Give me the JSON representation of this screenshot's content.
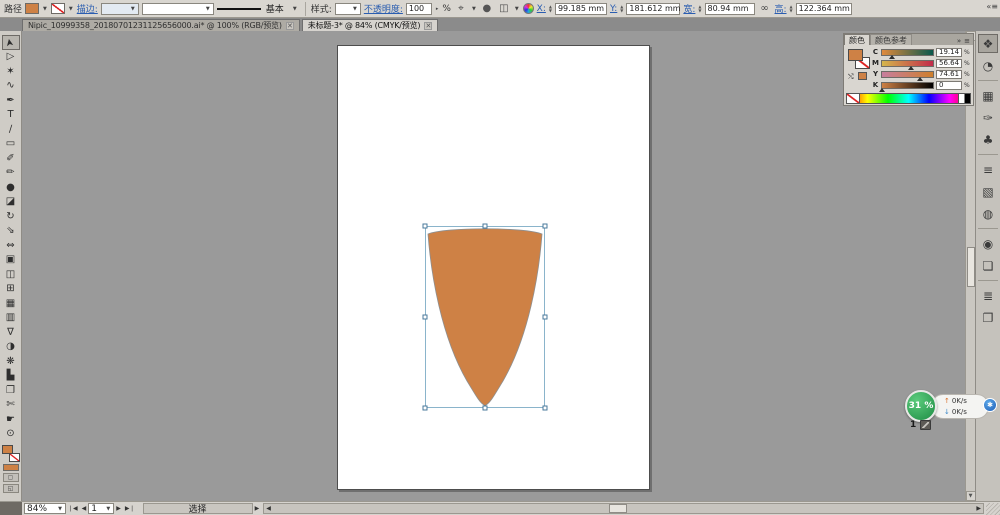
{
  "control_bar": {
    "object_label": "路径",
    "stroke_label": "描边:",
    "profile_value": "基本",
    "style_label": "样式:",
    "opacity_label": "不透明度:",
    "opacity_value": "100",
    "unit_percent": "%",
    "x_label": "X:",
    "x_value": "99.185 mm",
    "y_label": "Y:",
    "y_value": "181.612 mm",
    "w_label": "宽:",
    "w_value": "80.94 mm",
    "h_label": "高:",
    "h_value": "122.364 mm"
  },
  "tabs": [
    {
      "label": "Nipic_10999358_20180701231125656000.ai* @ 100% (RGB/预览)",
      "active": false
    },
    {
      "label": "未标题-3* @ 84% (CMYK/预览)",
      "active": true
    }
  ],
  "toolbar": {
    "tools": [
      {
        "name": "selection-tool",
        "glyph": "➤"
      },
      {
        "name": "direct-selection-tool",
        "glyph": "▷"
      },
      {
        "name": "magic-wand-tool",
        "glyph": "✶"
      },
      {
        "name": "lasso-tool",
        "glyph": "∿"
      },
      {
        "name": "pen-tool",
        "glyph": "✒"
      },
      {
        "name": "type-tool",
        "glyph": "T"
      },
      {
        "name": "line-segment-tool",
        "glyph": "∕"
      },
      {
        "name": "rectangle-tool",
        "glyph": "▭"
      },
      {
        "name": "paintbrush-tool",
        "glyph": "✐"
      },
      {
        "name": "pencil-tool",
        "glyph": "✏"
      },
      {
        "name": "blob-brush-tool",
        "glyph": "●"
      },
      {
        "name": "eraser-tool",
        "glyph": "◪"
      },
      {
        "name": "rotate-tool",
        "glyph": "↻"
      },
      {
        "name": "scale-tool",
        "glyph": "⇘"
      },
      {
        "name": "width-tool",
        "glyph": "⇔"
      },
      {
        "name": "free-transform-tool",
        "glyph": "▣"
      },
      {
        "name": "shape-builder-tool",
        "glyph": "◫"
      },
      {
        "name": "perspective-grid-tool",
        "glyph": "⊞"
      },
      {
        "name": "mesh-tool",
        "glyph": "▦"
      },
      {
        "name": "gradient-tool",
        "glyph": "▥"
      },
      {
        "name": "eyedropper-tool",
        "glyph": "∇"
      },
      {
        "name": "blend-tool",
        "glyph": "◑"
      },
      {
        "name": "symbol-sprayer-tool",
        "glyph": "❋"
      },
      {
        "name": "column-graph-tool",
        "glyph": "▙"
      },
      {
        "name": "artboard-tool",
        "glyph": "❐"
      },
      {
        "name": "slice-tool",
        "glyph": "✄"
      },
      {
        "name": "hand-tool",
        "glyph": "☛"
      },
      {
        "name": "zoom-tool",
        "glyph": "⊙"
      }
    ]
  },
  "color_panel": {
    "tab_color": "颜色",
    "tab_color_guide": "颜色参考",
    "sliders": [
      {
        "channel": "C",
        "value": "19.14",
        "pct": 19
      },
      {
        "channel": "M",
        "value": "56.64",
        "pct": 57
      },
      {
        "channel": "Y",
        "value": "74.61",
        "pct": 75
      },
      {
        "channel": "K",
        "value": "0",
        "pct": 0
      }
    ],
    "unit": "%"
  },
  "dock": {
    "icons": [
      {
        "name": "color-panel-icon",
        "glyph": "❖",
        "active": true
      },
      {
        "name": "color-guide-panel-icon",
        "glyph": "◔",
        "active": false
      },
      {
        "name": "swatches-panel-icon",
        "glyph": "▦",
        "active": false
      },
      {
        "name": "brushes-panel-icon",
        "glyph": "✑",
        "active": false
      },
      {
        "name": "symbols-panel-icon",
        "glyph": "♣",
        "active": false
      },
      {
        "name": "stroke-panel-icon",
        "glyph": "≡",
        "active": false
      },
      {
        "name": "gradient-panel-icon",
        "glyph": "▧",
        "active": false
      },
      {
        "name": "transparency-panel-icon",
        "glyph": "◍",
        "active": false
      },
      {
        "name": "appearance-panel-icon",
        "glyph": "◉",
        "active": false
      },
      {
        "name": "graphic-styles-panel-icon",
        "glyph": "❏",
        "active": false
      },
      {
        "name": "layers-panel-icon",
        "glyph": "≣",
        "active": false
      },
      {
        "name": "artboards-panel-icon",
        "glyph": "❐",
        "active": false
      }
    ]
  },
  "status_bar": {
    "zoom": "84%",
    "artboard_number": "1",
    "status": "选择"
  },
  "download_widget": {
    "progress": "31 %",
    "up_speed": "0K/s",
    "down_speed": "0K/s",
    "tray_count": "1"
  },
  "colors": {
    "shape_fill": "#CE8145",
    "selection_box": "#8AB4CB",
    "pasteboard": "#9A9A9A",
    "progress_green": "#2FA156"
  },
  "icons": {
    "dropdown": "▼",
    "spinner": "▸",
    "close": "✕",
    "collapse_right": "»",
    "panel_menu": "≡",
    "stepper_up": "▲",
    "stepper_down": "▼",
    "first": "❘◀",
    "prev": "◀",
    "next": "▶",
    "last": "▶❘",
    "scroll_left": "◀",
    "scroll_right": "▶",
    "scroll_up": "▲",
    "scroll_down": "▼",
    "link": "∞",
    "select_similar": "⌖",
    "recolor_dark": "●",
    "align": "◫",
    "up_arrow": "↑",
    "down_arrow": "↓",
    "badge_star": "✱",
    "dock_collapse": "«≡",
    "draw_mode": "▢",
    "screen_mode": "◱"
  }
}
